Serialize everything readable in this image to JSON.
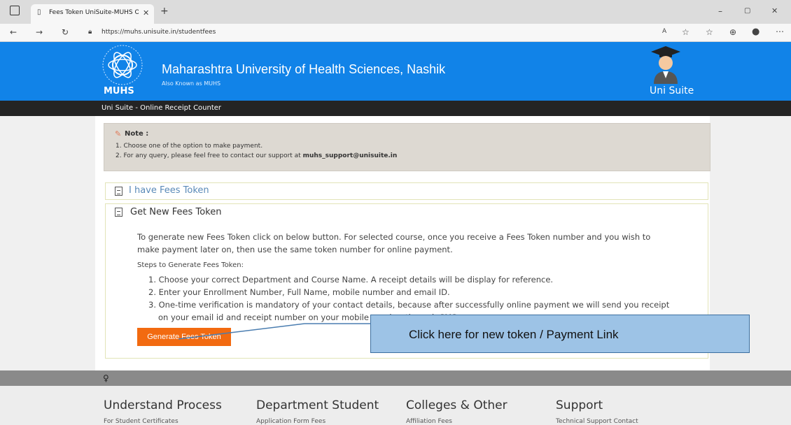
{
  "browser": {
    "tab_title": "Fees Token UniSuite-MUHS Onli",
    "url": "https://muhs.unisuite.in/studentfees"
  },
  "header": {
    "university_name": "Maharashtra University of Health Sciences, Nashik",
    "aka": "Also Known as MUHS",
    "logo_text": "MUHS",
    "suite_label": "Uni Suite",
    "subbar": "Uni Suite - Online Receipt Counter"
  },
  "note": {
    "title": "Note :",
    "line1": "1. Choose one of the option to make payment.",
    "line2_prefix": "2. For any query, please feel free to contact our support at ",
    "line2_email": "muhs_support@unisuite.in"
  },
  "panels": {
    "have_token": "I have Fees Token",
    "get_new": "Get New Fees Token"
  },
  "content": {
    "para1": "To generate new Fees Token click on below button. For selected course, once you receive a Fees Token number and you wish to",
    "para2": "make payment later on, then use the same token number for online payment.",
    "steps_title": "Steps to Generate Fees Token:",
    "step1": "1. Choose your correct Department and Course Name. A receipt details will be display for reference.",
    "step2": "2. Enter your Enrollment Number, Full Name, mobile number and email ID.",
    "step3a": "3. One-time verification is mandatory of your contact details, because after successfully online payment we will send you receipt",
    "step3b": "on your email id and receipt number on your mobile number through SMS.",
    "button": "Generate Fees Token"
  },
  "callout": "Click here for new token / Payment Link",
  "footer": {
    "col1_head": "Understand Process",
    "col1_link": "For Student Certificates",
    "col2_head": "Department Student",
    "col2_link": "Application Form Fees",
    "col3_head": "Colleges & Other",
    "col3_link": "Affiliation Fees",
    "col4_head": "Support",
    "col4_link": "Technical Support Contact"
  },
  "colors": {
    "header_blue": "#1183e8",
    "button_orange": "#f26a10",
    "callout_blue": "#9dc3e6"
  }
}
